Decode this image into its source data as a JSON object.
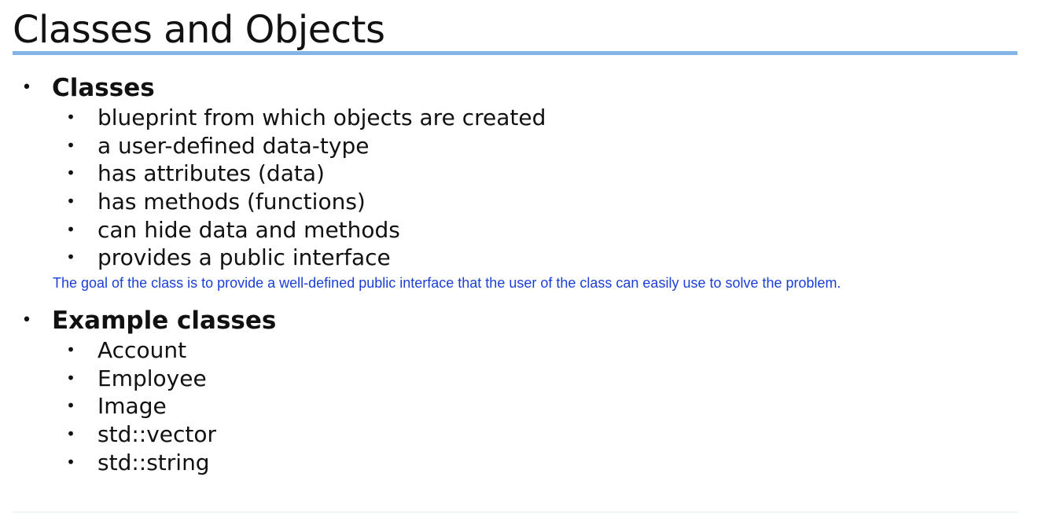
{
  "slide": {
    "title": "Classes and Objects",
    "colors": {
      "title_rule": "#84b3e6",
      "note_text": "#1a3fd6",
      "body_text": "#111111"
    }
  },
  "sections": [
    {
      "heading": "Classes",
      "items": [
        "blueprint from which objects are created",
        "a user-defined data-type",
        "has attributes (data)",
        "has methods (functions)",
        "can hide data and methods",
        "provides a public interface"
      ],
      "note": "The goal of the class is to provide a well-defined public interface that the user of the class can easily use to solve the problem."
    },
    {
      "heading": "Example classes",
      "items": [
        "Account",
        "Employee",
        "Image",
        "std::vector",
        "std::string"
      ]
    }
  ]
}
